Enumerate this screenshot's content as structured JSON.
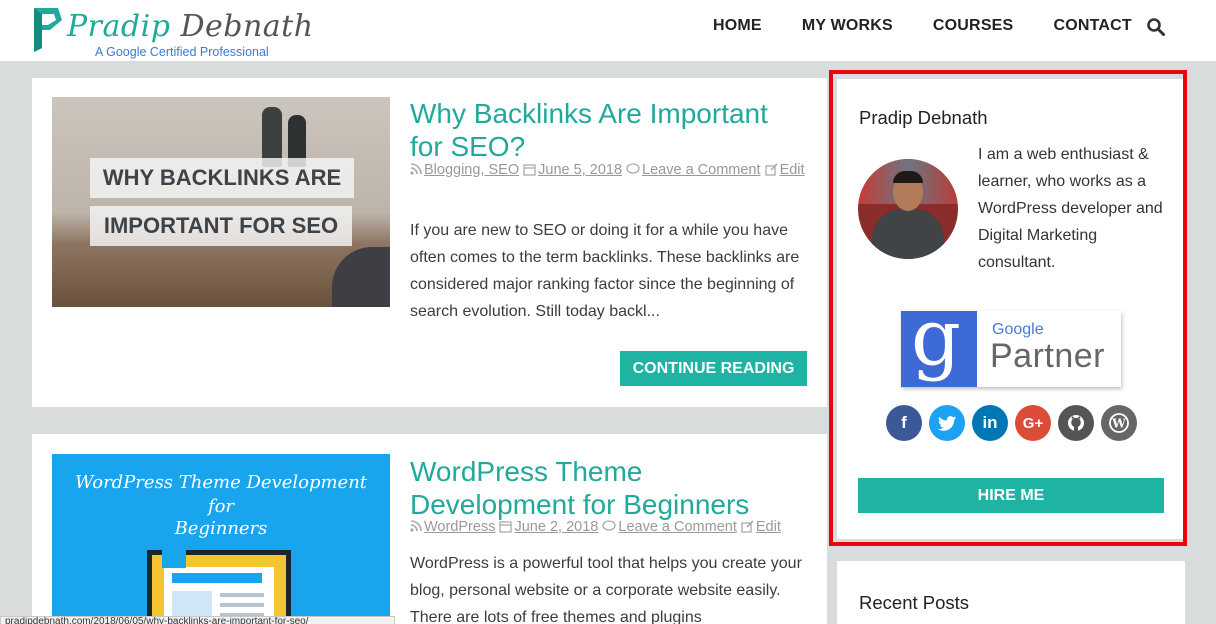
{
  "header": {
    "logo_first": "Pradip",
    "logo_last": "Debnath",
    "tagline": "A Google Certified Professional",
    "nav": [
      "HOME",
      "MY WORKS",
      "COURSES",
      "CONTACT"
    ]
  },
  "posts": [
    {
      "thumb_line1": "WHY BACKLINKS ARE",
      "thumb_line2": "IMPORTANT FOR SEO",
      "title_line1": "Why Backlinks Are Important",
      "title_line2": "for SEO?",
      "categories": "Blogging, SEO",
      "date": "June 5, 2018",
      "comment": "Leave a Comment",
      "edit": "Edit",
      "excerpt": "If you are new to SEO or doing it for a while you have often comes to the term backlinks. These backlinks are considered major ranking factor since the beginning of search evolution. Still today backl...",
      "button": "CONTINUE READING"
    },
    {
      "thumb_line1": "WordPress Theme Development",
      "thumb_line2": "for",
      "thumb_line3": "Beginners",
      "title_line1": "WordPress Theme",
      "title_line2": "Development for Beginners",
      "categories": "WordPress",
      "date": "June 2, 2018",
      "comment": "Leave a Comment",
      "edit": "Edit",
      "excerpt": "WordPress is a powerful tool that helps you create your blog, personal website or a corporate website easily. There are lots of free themes and plugins"
    }
  ],
  "sidebar": {
    "author_title": "Pradip Debnath",
    "bio": "I am a web enthusiast & learner, who works as a WordPress developer and Digital Marketing consultant.",
    "badge_google": "Google",
    "badge_partner": "Partner",
    "socials": [
      {
        "name": "facebook",
        "glyph": "f",
        "color": "#3b5998"
      },
      {
        "name": "twitter",
        "glyph": "t",
        "color": "#1da1f2"
      },
      {
        "name": "linkedin",
        "glyph": "in",
        "color": "#0077b5"
      },
      {
        "name": "google-plus",
        "glyph": "G+",
        "color": "#dd4b39"
      },
      {
        "name": "github",
        "glyph": "gh",
        "color": "#555555"
      },
      {
        "name": "wordpress",
        "glyph": "W",
        "color": "#666666"
      }
    ],
    "hire_button": "HIRE ME",
    "recent_title": "Recent Posts"
  },
  "status_url": "pradipdebnath.com/2018/06/05/why-backlinks-are-important-for-seo/",
  "colors": {
    "accent": "#21a99b",
    "button": "#1fb3a4",
    "highlight": "#e8060d"
  }
}
